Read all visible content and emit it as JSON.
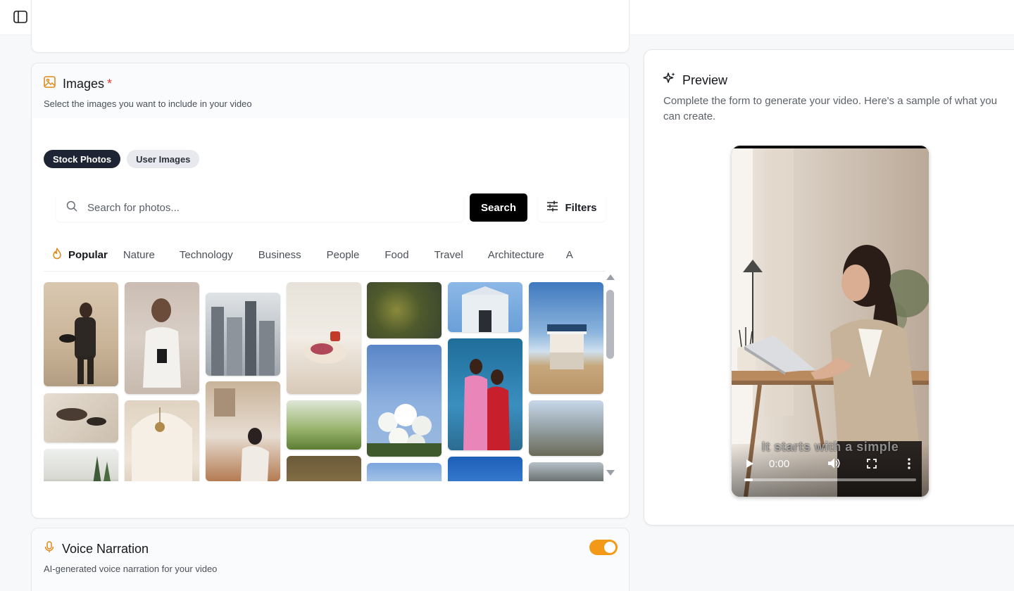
{
  "app": {
    "sidebar_toggle_icon": "sidebar-panel-icon"
  },
  "images_section": {
    "title": "Images",
    "required_mark": "*",
    "subtitle": "Select the images you want to include in your video",
    "icon": "image-icon",
    "source_tabs": [
      {
        "label": "Stock Photos",
        "active": true
      },
      {
        "label": "User Images",
        "active": false
      }
    ],
    "search": {
      "placeholder": "Search for photos...",
      "value": "",
      "button_label": "Search",
      "filters_label": "Filters"
    },
    "categories": [
      "Popular",
      "Nature",
      "Technology",
      "Business",
      "People",
      "Food",
      "Travel",
      "Architecture",
      "A"
    ],
    "active_category": "Popular"
  },
  "voice_section": {
    "title": "Voice Narration",
    "subtitle": "AI-generated voice narration for your video",
    "icon": "microphone-icon",
    "enabled": true
  },
  "preview": {
    "title": "Preview",
    "icon": "sparkles-icon",
    "description": "Complete the form to generate your video. Here's a sample of what you can create.",
    "video": {
      "current_time": "0:00",
      "caption": "It starts with a simple",
      "progress": 0.05
    }
  },
  "colors": {
    "accent": "#f29a18",
    "primary_dark": "#1e2433",
    "required": "#e03a2f"
  }
}
